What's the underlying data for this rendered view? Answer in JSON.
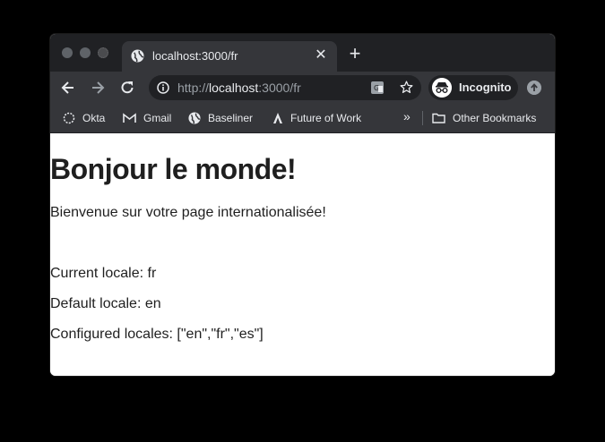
{
  "browser": {
    "tab": {
      "title": "localhost:3000/fr",
      "favicon": "globe-icon"
    },
    "new_tab_icon": "+",
    "close_icon": "✕",
    "address": {
      "scheme": "http://",
      "host": "localhost",
      "rest": ":3000/fr"
    },
    "profile_label": "Incognito",
    "bookmarks": [
      {
        "label": "Okta",
        "icon": "okta-icon"
      },
      {
        "label": "Gmail",
        "icon": "gmail-icon"
      },
      {
        "label": "Baseliner",
        "icon": "globe-icon"
      },
      {
        "label": "Future of Work",
        "icon": "future-of-work-icon"
      }
    ],
    "bookmarks_overflow": "»",
    "other_bookmarks": "Other Bookmarks"
  },
  "page": {
    "heading": "Bonjour le monde!",
    "welcome": "Bienvenue sur votre page internationalisée!",
    "current_locale": "Current locale: fr",
    "default_locale": "Default locale: en",
    "configured_locales": "Configured locales: [\"en\",\"fr\",\"es\"]"
  }
}
